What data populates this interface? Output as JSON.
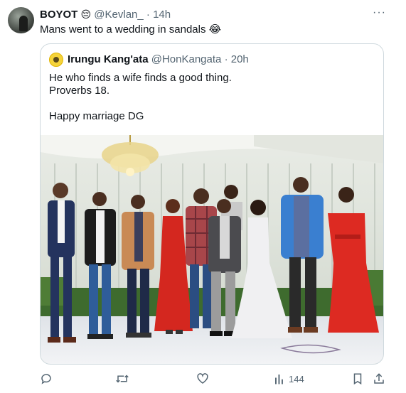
{
  "tweet": {
    "author_name": "BOYOT",
    "author_emoji": "😔",
    "handle": "@Kevlan_",
    "separator": "·",
    "time": "14h",
    "text": "Mans went to a wedding in sandals 😂",
    "more_label": "···"
  },
  "quote": {
    "author_name": "Irungu Kang'ata",
    "handle": "@HonKangata",
    "separator": "·",
    "time": "20h",
    "lines": [
      "He who finds a wife finds a good thing.",
      "Proverbs 18.",
      "",
      "Happy marriage DG"
    ],
    "photo_icon": "wedding-group-photo"
  },
  "actions": {
    "views_count": "144"
  },
  "colors": {
    "text_primary": "#0f1419",
    "text_secondary": "#536471",
    "border": "#cfd9de"
  }
}
